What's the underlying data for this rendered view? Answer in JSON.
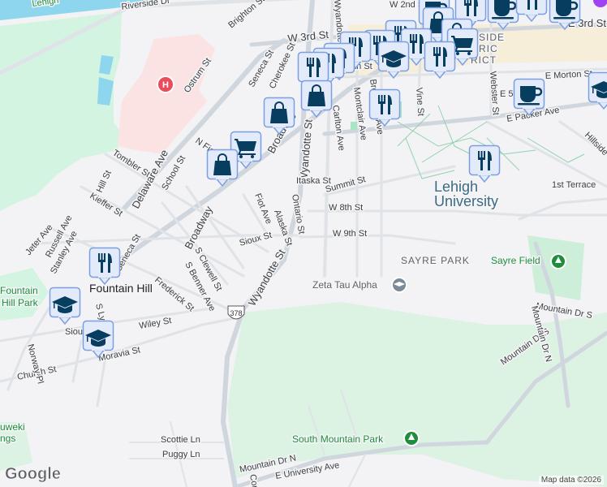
{
  "map": {
    "attribution": "Map data ©2026",
    "logo": "Google",
    "route_shield": "378",
    "colors": {
      "background": "#f3f2f4",
      "park": "#d4f4e2",
      "water": "#8ed6ee",
      "hospital": "#fbe3e3",
      "marker_fill": "#e3ebfb",
      "marker_border": "#7b9fe0",
      "marker_icon": "#073d5e",
      "downtown": "#f8edcf"
    },
    "labels": {
      "lehigh_river": "Lehigh",
      "riverside": "Riverside Dr",
      "brighton": "Brighton St",
      "w3rd": "W 3rd St",
      "w2nd": "W 2nd St",
      "e3rd": "E 3rd St",
      "ostrum": "Ostrum St",
      "seneca1": "Seneca St",
      "cherokee": "Cherokee St",
      "nfiot": "N Fiot",
      "tombler": "Tombler St",
      "delaware": "Delaware Ave",
      "school": "School St",
      "hill": "Hill St",
      "kieffer": "Kieffer St",
      "broadway1": "Broadway",
      "broadway2": "Broadway",
      "wyandotte1": "Wyandotte St",
      "wyandotte2": "Wyandotte St",
      "wyandotte3": "Wyandotte St",
      "carlton": "Carlton Ave",
      "montclair": "Montclair Ave",
      "vine": "Vine St",
      "webster": "Webster St",
      "emorton": "E Morton St",
      "e5th": "E 5th",
      "epacker": "E Packer Ave",
      "hillside": "Hillside",
      "first_terrace": "1st Terrace",
      "summit": "Summit St",
      "itaska": "Itaska St",
      "ontario": "Ontario St",
      "fiot": "Fiot Ave",
      "alaska": "Alaska St",
      "w8th": "W 8th St",
      "w9th": "W 9th St",
      "sioux": "Sioux St",
      "sclewell": "S Clewell St",
      "sbenner": "S Benner Ave",
      "frederick": "Frederick St",
      "seneca2": "Seneca St",
      "stanley": "Stanley Ave",
      "russell": "Russell Ave",
      "jeter": "Jeter Ave",
      "fountain_hill": "Fountain Hill",
      "fh_park1": "Fountain",
      "fh_park2": "Hill Park",
      "wiley": "Wiley St",
      "moravia": "Moravia St",
      "church": "Church St",
      "norway": "Norway Pl",
      "sly": "S Ly",
      "sioux2": "Siou",
      "lehigh_u1": "Lehigh",
      "lehigh_u2": "University",
      "sayre_park": "SAYRE PARK",
      "sayre_field": "Sayre Field",
      "zeta": "Zeta Tau Alpha",
      "mtn_s1": "Mountain Dr S",
      "mtn_s2": "Mountain Dr S",
      "mtn_n1": "Mountain Dr N",
      "mtn_n2": "Mountain Dr N",
      "south_mtn_park": "South Mountain Park",
      "scottie": "Scottie Ln",
      "puggy": "Puggy Ln",
      "univ_ave": "E University Ave",
      "uweki1": "uweki",
      "uweki2": "ngs",
      "hist1": "SIDE",
      "hist2": "RIC",
      "hist3": "RICT",
      "fourth": "4th St",
      "bro": "Brodhead Ave",
      "cor": "Cor"
    },
    "markers": [
      {
        "type": "restaurant",
        "icon": "fork-knife-icon"
      },
      {
        "type": "shopping",
        "icon": "shopping-bag-icon"
      },
      {
        "type": "grocery",
        "icon": "shopping-cart-icon"
      },
      {
        "type": "school",
        "icon": "graduation-cap-icon"
      },
      {
        "type": "cafe",
        "icon": "coffee-cup-icon"
      },
      {
        "type": "hospital",
        "icon": "hospital-icon"
      },
      {
        "type": "university",
        "icon": "graduation-cap-small-icon"
      },
      {
        "type": "park",
        "icon": "tree-icon"
      }
    ]
  }
}
